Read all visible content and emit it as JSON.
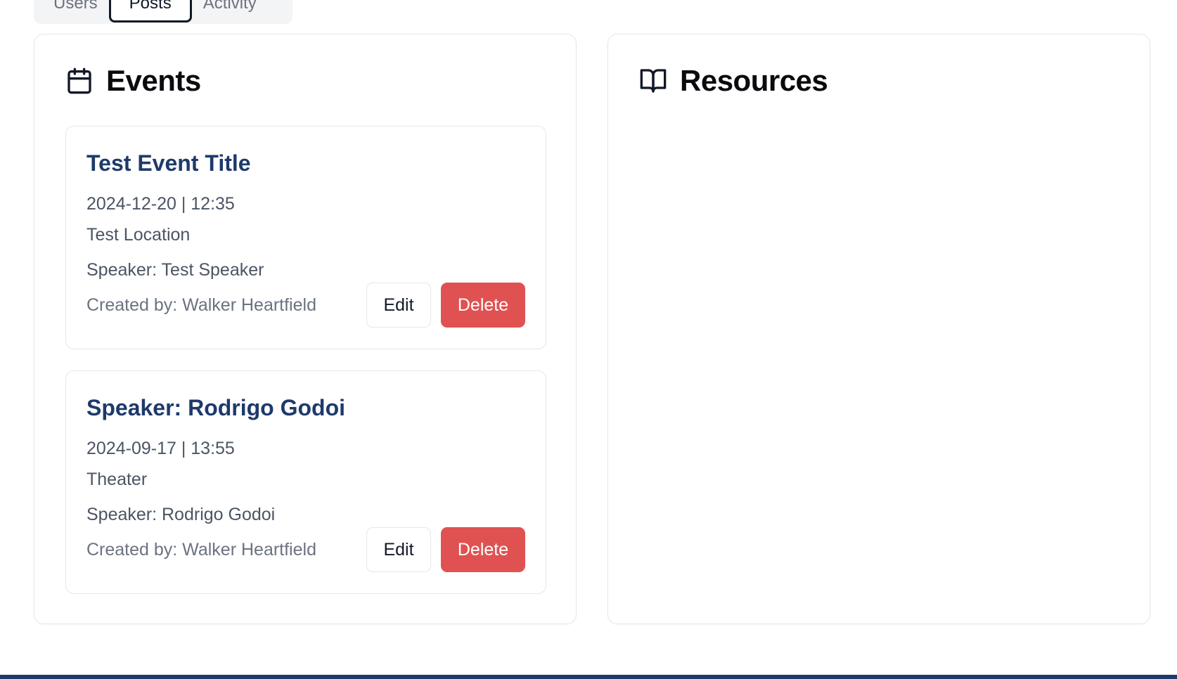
{
  "tabs": [
    {
      "label": "Users",
      "active": false
    },
    {
      "label": "Posts",
      "active": true
    },
    {
      "label": "Activity",
      "active": false
    }
  ],
  "events_panel": {
    "title": "Events",
    "icon": "calendar-icon",
    "events": [
      {
        "title": "Test Event Title",
        "datetime": "2024-12-20 | 12:35",
        "location": "Test Location",
        "speaker": "Speaker: Test Speaker",
        "created_by": "Created by: Walker Heartfield",
        "edit_label": "Edit",
        "delete_label": "Delete"
      },
      {
        "title": "Speaker: Rodrigo Godoi",
        "datetime": "2024-09-17 | 13:55",
        "location": "Theater",
        "speaker": "Speaker: Rodrigo Godoi",
        "created_by": "Created by: Walker Heartfield",
        "edit_label": "Edit",
        "delete_label": "Delete"
      }
    ]
  },
  "resources_panel": {
    "title": "Resources",
    "icon": "book-open-icon"
  },
  "colors": {
    "event_title": "#1e3a6b",
    "delete_button": "#e05252",
    "footer": "#1e3a6b"
  }
}
